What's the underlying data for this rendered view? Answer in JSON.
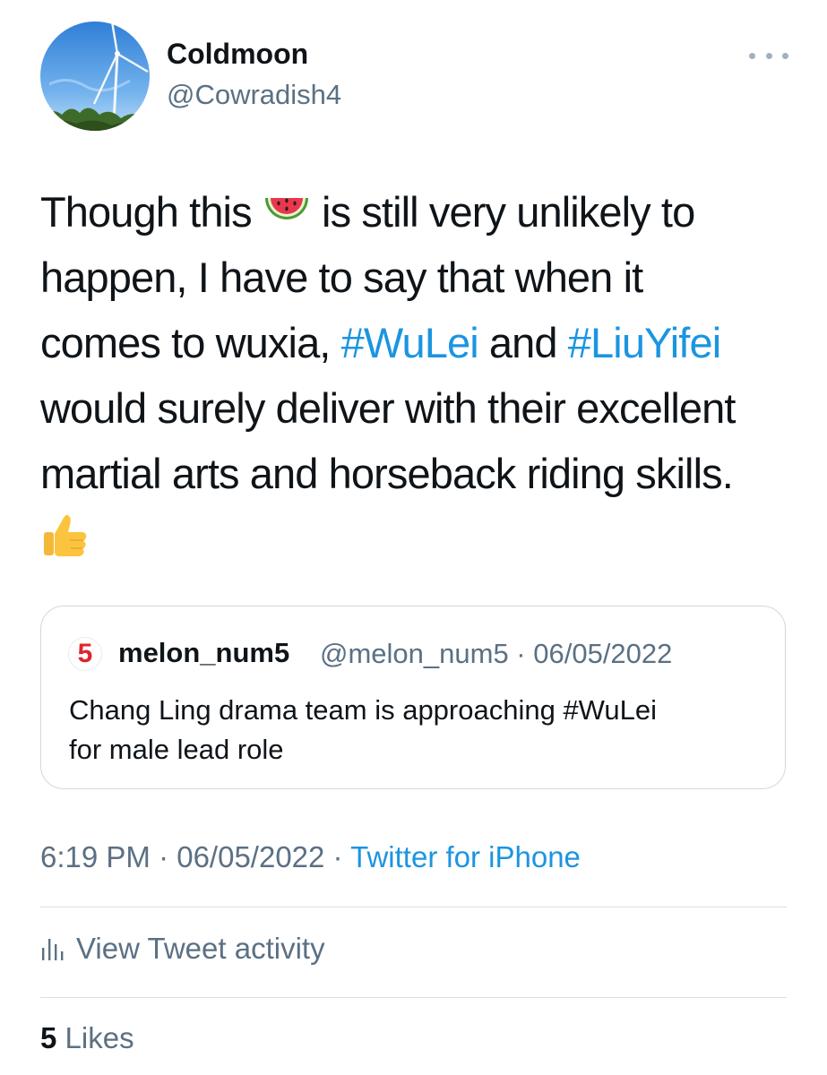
{
  "author": {
    "display_name": "Coldmoon",
    "handle": "@Cowradish4",
    "avatar": "wind-turbine-photo"
  },
  "more_icon": "more-horizontal-icon",
  "tweet": {
    "lines": [
      {
        "before": "Though this ",
        "emoji": "watermelon",
        "after": " is still very unlikely to"
      },
      "happen, I have to say that when it",
      {
        "before": "comes to wuxia, ",
        "hashtag1": "#WuLei",
        "middle": " and ",
        "hashtag2": "#LiuYifei"
      },
      "would surely deliver with their excellent",
      "martial arts and horseback riding skills."
    ],
    "trailing_emoji": "thumbs-up"
  },
  "quote": {
    "avatar_text": "5",
    "name": "melon_num5",
    "meta": "@melon_num5 · 06/05/2022",
    "text_line1": "Chang Ling drama team is approaching #WuLei",
    "text_line2": "for male lead role"
  },
  "timestamp": {
    "time_date": "6:19 PM · 06/05/2022 · ",
    "source": "Twitter for iPhone"
  },
  "activity": {
    "label": "View Tweet activity",
    "icon": "analytics-bar-icon"
  },
  "likes": {
    "count": "5",
    "label": "Likes"
  },
  "colors": {
    "link": "#1b95e0",
    "secondary_text": "#5b7083",
    "primary_text": "#0f1419",
    "border": "#cfd9de"
  }
}
